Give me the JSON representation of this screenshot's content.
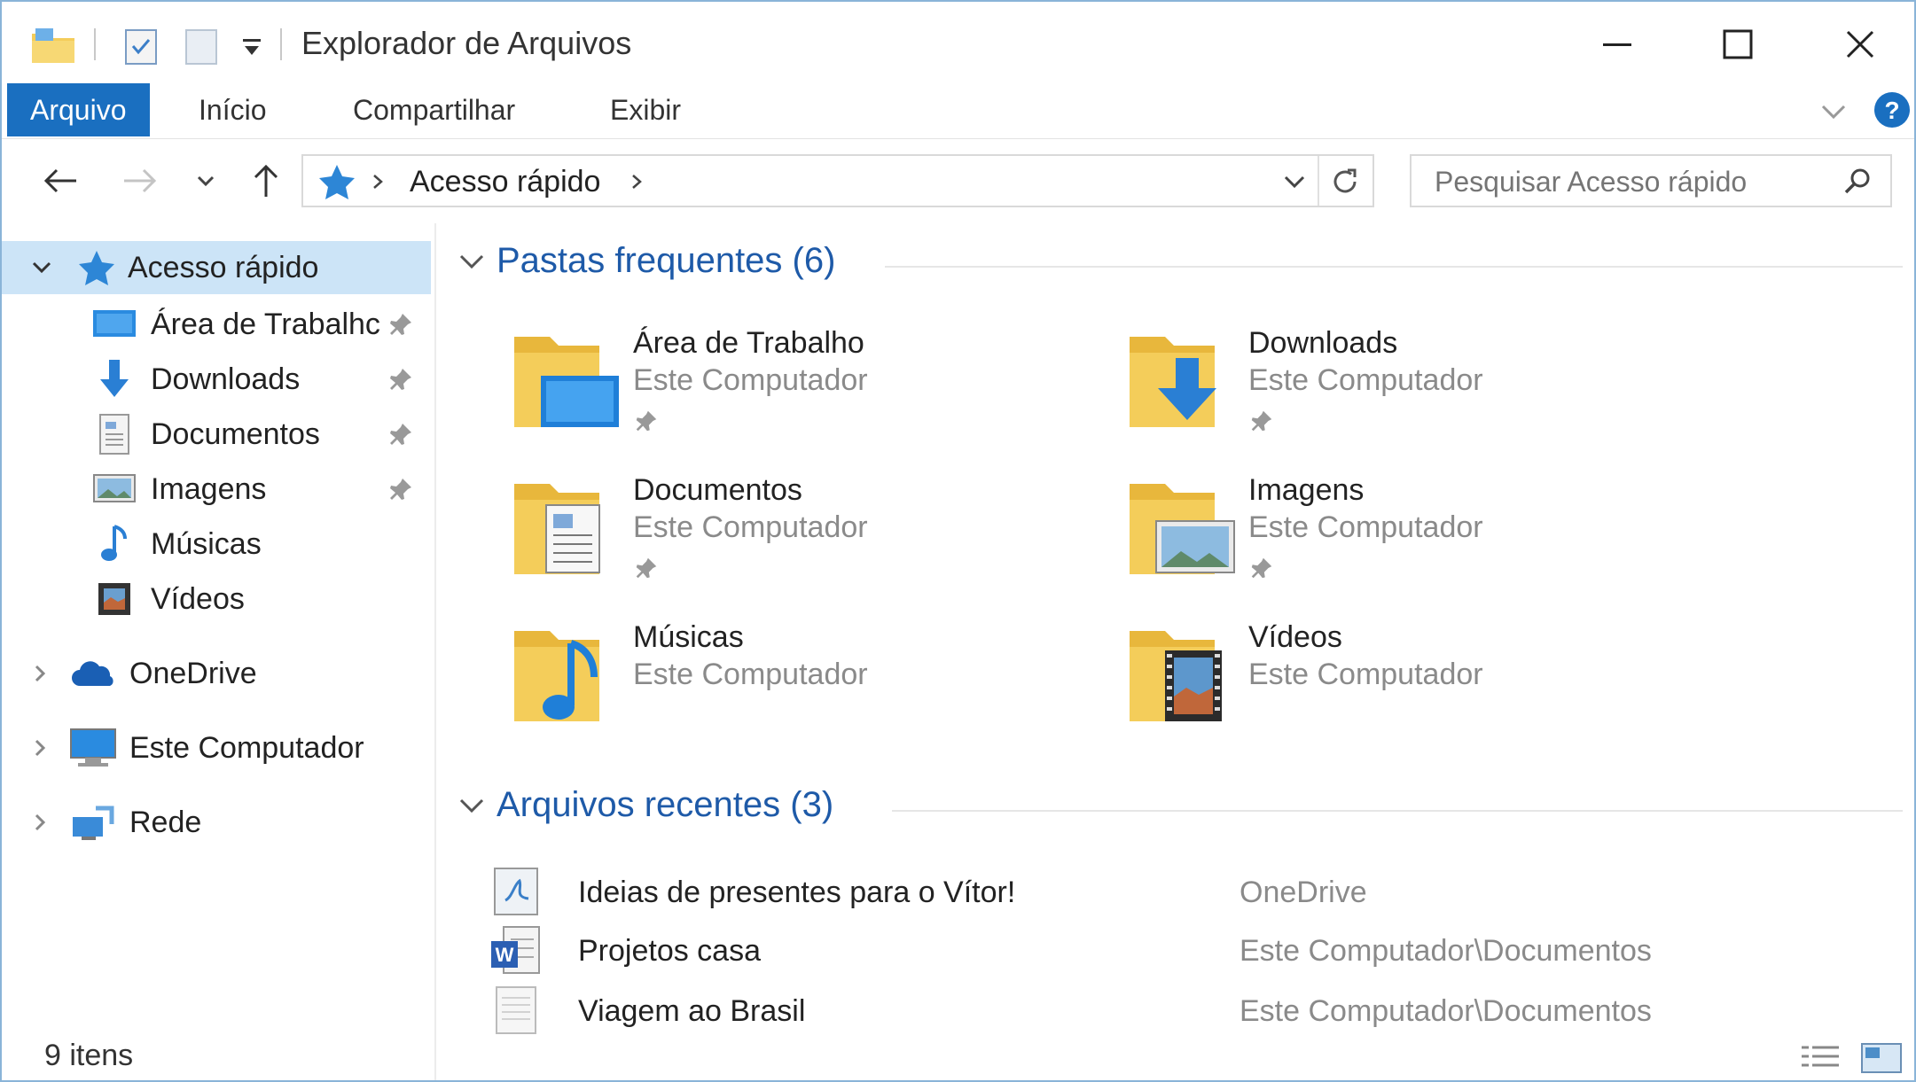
{
  "window": {
    "title": "Explorador de Arquivos"
  },
  "ribbon": {
    "tabs": [
      {
        "label": "Arquivo"
      },
      {
        "label": "Início"
      },
      {
        "label": "Compartilhar"
      },
      {
        "label": "Exibir"
      }
    ]
  },
  "address": {
    "path": "Acesso rápido"
  },
  "search": {
    "placeholder": "Pesquisar Acesso rápido"
  },
  "nav": {
    "quick_access": "Acesso rápido",
    "items": [
      {
        "label": "Área de Trabalhc",
        "pinned": true
      },
      {
        "label": "Downloads",
        "pinned": true
      },
      {
        "label": "Documentos",
        "pinned": true
      },
      {
        "label": "Imagens",
        "pinned": true
      },
      {
        "label": "Músicas",
        "pinned": false
      },
      {
        "label": "Vídeos",
        "pinned": false
      }
    ],
    "roots": [
      {
        "label": "OneDrive"
      },
      {
        "label": "Este Computador"
      },
      {
        "label": "Rede"
      }
    ]
  },
  "frequent": {
    "header": "Pastas frequentes (6)",
    "folders": [
      {
        "name": "Área de Trabalho",
        "location": "Este Computador",
        "pinned": true,
        "icon": "desktop-folder-icon"
      },
      {
        "name": "Downloads",
        "location": "Este Computador",
        "pinned": true,
        "icon": "downloads-folder-icon"
      },
      {
        "name": "Documentos",
        "location": "Este Computador",
        "pinned": true,
        "icon": "documents-folder-icon"
      },
      {
        "name": "Imagens",
        "location": "Este Computador",
        "pinned": true,
        "icon": "pictures-folder-icon"
      },
      {
        "name": "Músicas",
        "location": "Este Computador",
        "pinned": false,
        "icon": "music-folder-icon"
      },
      {
        "name": "Vídeos",
        "location": "Este Computador",
        "pinned": false,
        "icon": "videos-folder-icon"
      }
    ]
  },
  "recent": {
    "header": "Arquivos recentes (3)",
    "files": [
      {
        "name": "Ideias de presentes para o Vítor!",
        "location": "OneDrive"
      },
      {
        "name": "Projetos casa",
        "location": "Este Computador\\Documentos"
      },
      {
        "name": "Viagem ao Brasil",
        "location": "Este Computador\\Documentos"
      }
    ]
  },
  "status": {
    "count": "9 itens"
  },
  "colors": {
    "accent": "#1a6fc0",
    "selection": "#cce4f7",
    "group_header": "#1e5aa8",
    "folder": "#f4cd5a"
  }
}
